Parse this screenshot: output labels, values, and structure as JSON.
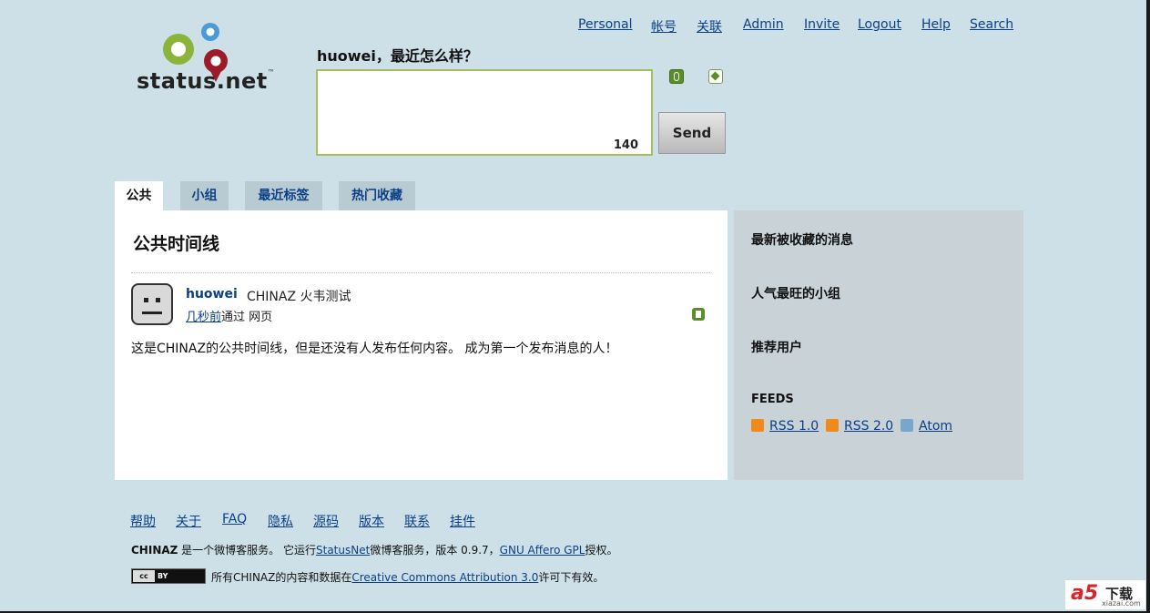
{
  "logo": {
    "text": "status.net",
    "tm": "™"
  },
  "nav": [
    "Personal",
    "帐号",
    "关联",
    "Admin",
    "Invite",
    "Logout",
    "Help",
    "Search"
  ],
  "notice_form": {
    "greeting": "huowei，最近怎么样？",
    "char_count": "140",
    "send_label": "Send"
  },
  "tabs": [
    "公共",
    "小组",
    "最近标签",
    "热门收藏"
  ],
  "content": {
    "title": "公共时间线",
    "notice": {
      "author": "huowei",
      "text": "CHINAZ 火韦测试",
      "time": "几秒前",
      "via_prefix": "通过",
      "source": "网页"
    },
    "empty_message": "这是CHINAZ的公共时间线，但是还没有人发布任何内容。 成为第一个发布消息的人！"
  },
  "aside": {
    "popular": "最新被收藏的消息",
    "groups": "人气最旺的小组",
    "featured": "推荐用户",
    "feeds_title": "FEEDS",
    "feeds": [
      "RSS 1.0",
      "RSS 2.0",
      "Atom"
    ]
  },
  "footer": {
    "links": [
      "帮助",
      "关于",
      "FAQ",
      "隐私",
      "源码",
      "版本",
      "联系",
      "挂件"
    ],
    "site_name": "CHINAZ",
    "line1_a": " 是一个微博客服务。 它运行",
    "statusnet_link": "StatusNet",
    "line1_b": "微博客服务，版本 0.9.7，",
    "gpl_link": "GNU Affero GPL",
    "line1_c": "授权。",
    "license_badge_cc": "cc",
    "license_badge_by": "BY",
    "line2_a": "所有CHINAZ的内容和数据在",
    "cc_link": "Creative Commons Attribution 3.0",
    "line2_b": "许可下有效。"
  },
  "watermark": {
    "brand": "a5",
    "cn": "下载",
    "site": "xiazai.com"
  }
}
